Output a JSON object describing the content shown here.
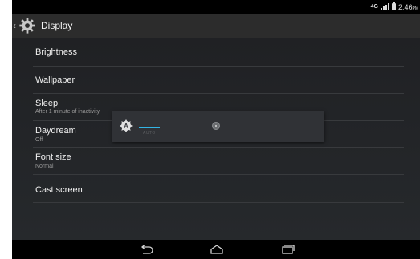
{
  "status_bar": {
    "network": "4G",
    "time": "2:46",
    "ampm": "PM"
  },
  "action_bar": {
    "title": "Display"
  },
  "settings": [
    {
      "title": "Brightness",
      "subtitle": ""
    },
    {
      "title": "Wallpaper",
      "subtitle": ""
    },
    {
      "title": "Sleep",
      "subtitle": "After 1 minute of inactivity"
    },
    {
      "title": "Daydream",
      "subtitle": "Off"
    },
    {
      "title": "Font size",
      "subtitle": "Normal"
    },
    {
      "title": "Cast screen",
      "subtitle": ""
    }
  ],
  "brightness_popup": {
    "auto_badge": "A",
    "auto_label": "AUTO",
    "level": 0.35
  },
  "colors": {
    "accent": "#33b5e5",
    "background": "#1f1f1f",
    "popup": "#303236"
  },
  "icons": {
    "settings": "gear-icon",
    "auto_brightness": "auto-brightness-icon",
    "back": "back-icon",
    "home": "home-icon",
    "recents": "recents-icon"
  }
}
